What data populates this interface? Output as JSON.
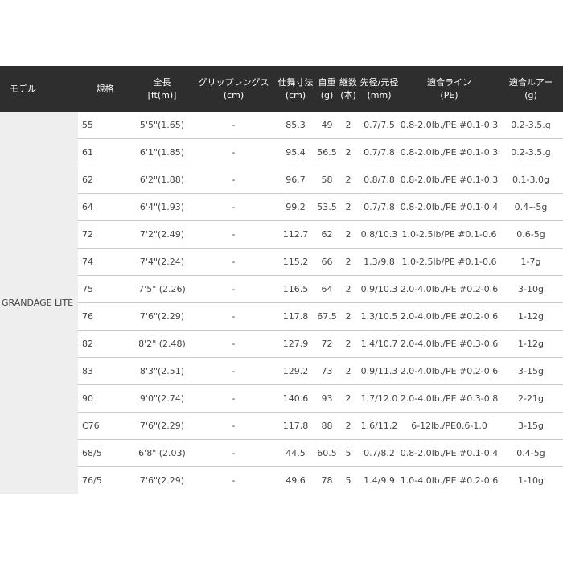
{
  "headers": {
    "model": "モデル",
    "spec": "規格",
    "length": "全長",
    "length_unit": "[ft(m)]",
    "grip": "グリップレングス",
    "grip_unit": "(cm)",
    "closed": "仕舞寸法",
    "closed_unit": "(cm)",
    "weight": "自重",
    "weight_unit": "(g)",
    "pieces": "継数",
    "pieces_unit": "(本)",
    "tip": "先径/元径",
    "tip_unit": "(mm)",
    "line": "適合ライン",
    "line_unit": "(PE)",
    "lure": "適合ルアー",
    "lure_unit": "(g)"
  },
  "model_name": "GRANDAGE LITE",
  "rows": [
    {
      "spec": "55",
      "length": "5'5\"(1.65)",
      "grip": "-",
      "closed": "85.3",
      "weight": "49",
      "pieces": "2",
      "tip": "0.7/7.5",
      "line": "0.8-2.0lb./PE #0.1-0.3",
      "lure": "0.2-3.5.g"
    },
    {
      "spec": "61",
      "length": "6'1\"(1.85)",
      "grip": "-",
      "closed": "95.4",
      "weight": "56.5",
      "pieces": "2",
      "tip": "0.7/7.8",
      "line": "0.8-2.0lb./PE #0.1-0.3",
      "lure": "0.2-3.5.g"
    },
    {
      "spec": "62",
      "length": "6'2\"(1.88)",
      "grip": "-",
      "closed": "96.7",
      "weight": "58",
      "pieces": "2",
      "tip": "0.8/7.8",
      "line": "0.8-2.0lb./PE #0.1-0.3",
      "lure": "0.1-3.0g"
    },
    {
      "spec": "64",
      "length": "6'4\"(1.93)",
      "grip": "-",
      "closed": "99.2",
      "weight": "53.5",
      "pieces": "2",
      "tip": "0.7/7.8",
      "line": "0.8-2.0lb./PE #0.1-0.4",
      "lure": "0.4~5g"
    },
    {
      "spec": "72",
      "length": "7'2\"(2.49)",
      "grip": "-",
      "closed": "112.7",
      "weight": "62",
      "pieces": "2",
      "tip": "0.8/10.3",
      "line": "1.0-2.5lb/PE #0.1-0.6",
      "lure": "0.6-5g"
    },
    {
      "spec": "74",
      "length": "7'4\"(2.24)",
      "grip": "-",
      "closed": "115.2",
      "weight": "66",
      "pieces": "2",
      "tip": "1.3/9.8",
      "line": "1.0-2.5lb/PE #0.1-0.6",
      "lure": "1-7g"
    },
    {
      "spec": "75",
      "length": "7'5\" (2.26)",
      "grip": "-",
      "closed": "116.5",
      "weight": "64",
      "pieces": "2",
      "tip": "0.9/10.3",
      "line": "2.0-4.0lb./PE #0.2-0.6",
      "lure": "3-10g"
    },
    {
      "spec": "76",
      "length": "7'6\"(2.29)",
      "grip": "-",
      "closed": "117.8",
      "weight": "67.5",
      "pieces": "2",
      "tip": "1.3/10.5",
      "line": "2.0-4.0lb./PE #0.2-0.6",
      "lure": "1-12g"
    },
    {
      "spec": "82",
      "length": "8'2\" (2.48)",
      "grip": "-",
      "closed": "127.9",
      "weight": "72",
      "pieces": "2",
      "tip": "1.4/10.7",
      "line": "2.0-4.0lb./PE #0.3-0.6",
      "lure": "1-12g"
    },
    {
      "spec": "83",
      "length": "8'3\"(2.51)",
      "grip": "-",
      "closed": "129.2",
      "weight": "73",
      "pieces": "2",
      "tip": "0.9/11.3",
      "line": "2.0-4.0lb./PE #0.2-0.6",
      "lure": "3-15g"
    },
    {
      "spec": "90",
      "length": "9'0\"(2.74)",
      "grip": "-",
      "closed": "140.6",
      "weight": "93",
      "pieces": "2",
      "tip": "1.7/12.0",
      "line": "2.0-4.0lb./PE #0.3-0.8",
      "lure": "2-21g"
    },
    {
      "spec": "C76",
      "length": "7'6\"(2.29)",
      "grip": "-",
      "closed": "117.8",
      "weight": "88",
      "pieces": "2",
      "tip": "1.6/11.2",
      "line": "6-12lb./PE0.6-1.0",
      "lure": "3-15g"
    },
    {
      "spec": "68/5",
      "length": "6'8\" (2.03)",
      "grip": "-",
      "closed": "44.5",
      "weight": "60.5",
      "pieces": "5",
      "tip": "0.7/8.2",
      "line": "0.8-2.0lb./PE #0.1-0.4",
      "lure": "0.4-5g"
    },
    {
      "spec": "76/5",
      "length": "7'6\"(2.29)",
      "grip": "-",
      "closed": "49.6",
      "weight": "78",
      "pieces": "5",
      "tip": "1.4/9.9",
      "line": "1.0-4.0lb./PE #0.2-0.6",
      "lure": "1-10g"
    }
  ]
}
